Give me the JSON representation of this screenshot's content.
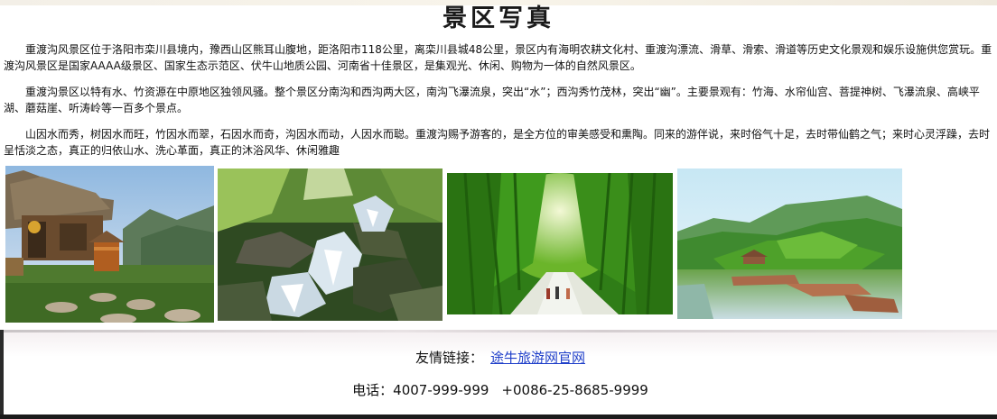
{
  "page": {
    "title": "景区写真"
  },
  "intro": {
    "paragraphs": [
      "重渡沟风景区位于洛阳市栾川县境内，豫西山区熊耳山腹地，距洛阳市118公里，离栾川县城48公里，景区内有海明农耕文化村、重渡沟漂流、滑草、滑索、滑道等历史文化景观和娱乐设施供您赏玩。重渡沟风景区是国家AAAA级景区、国家生态示范区、伏牛山地质公园、河南省十佳景区，是集观光、休闲、购物为一体的自然风景区。",
      "重渡沟景区以特有水、竹资源在中原地区独领风骚。整个景区分南沟和西沟两大区，南沟飞瀑流泉，突出“水”；西沟秀竹茂林，突出“幽”。主要景观有：竹海、水帘仙宫、菩提神树、飞瀑流泉、高峡平湖、蘑菇崖、听涛岭等一百多个景点。",
      "山因水而秀，树因水而旺，竹因水而翠，石因水而奇，沟因水而动，人因水而聪。重渡沟赐予游客的，是全方位的审美感受和熏陶。同来的游伴说，来时俗气十足，去时带仙鹤之气；来时心灵浮躁，去时呈恬淡之态，真正的归依山水、洗心革面，真正的沐浴风华、休闲雅趣"
    ]
  },
  "gallery": {
    "photos": [
      {
        "subject": "thatched-hut-village"
      },
      {
        "subject": "waterfall-stream"
      },
      {
        "subject": "bamboo-path"
      },
      {
        "subject": "lake-pavilion"
      }
    ]
  },
  "footer": {
    "links_label": "友情链接：",
    "link_text": "途牛旅游网官网",
    "phone_label": "电话：4007-999-999",
    "phone_intl": "+0086-25-8685-9999"
  },
  "colors": {
    "link": "#1f3fc9",
    "text": "#111111",
    "bottom_bar": "#1b1b1b"
  }
}
